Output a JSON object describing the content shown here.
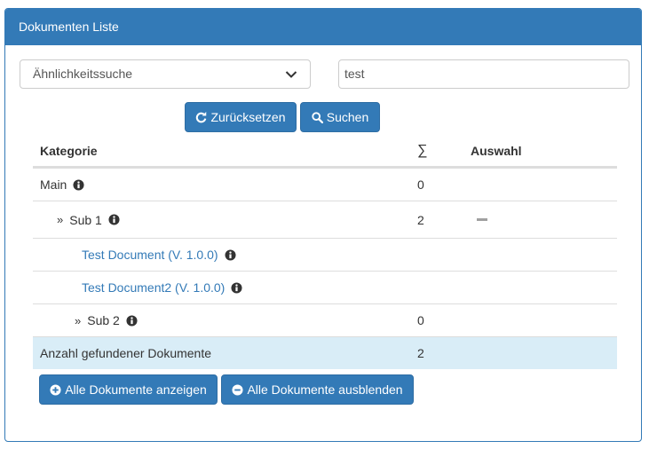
{
  "panel": {
    "title": "Dokumenten Liste"
  },
  "search": {
    "mode_value": "Ähnlichkeitssuche",
    "query_value": "test",
    "reset_label": "Zurücksetzen",
    "search_label": "Suchen"
  },
  "table": {
    "headers": {
      "category": "Kategorie",
      "sum": "∑",
      "selection": "Auswahl"
    },
    "rows": [
      {
        "label": "Main",
        "count": "0"
      },
      {
        "label": "Sub 1",
        "count": "2"
      },
      {
        "label": "Test Document (V. 1.0.0)",
        "count": ""
      },
      {
        "label": "Test Document2 (V. 1.0.0)",
        "count": ""
      },
      {
        "label": "Sub 2",
        "count": "0"
      }
    ],
    "footer": {
      "label": "Anzahl gefundener Dokumente",
      "count": "2"
    }
  },
  "actions": {
    "show_all_label": "Alle Dokumente anzeigen",
    "hide_all_label": "Alle Dokumente ausblenden"
  },
  "colors": {
    "primary": "#337ab7",
    "info_row": "#d9edf7",
    "border": "#dddddd"
  }
}
